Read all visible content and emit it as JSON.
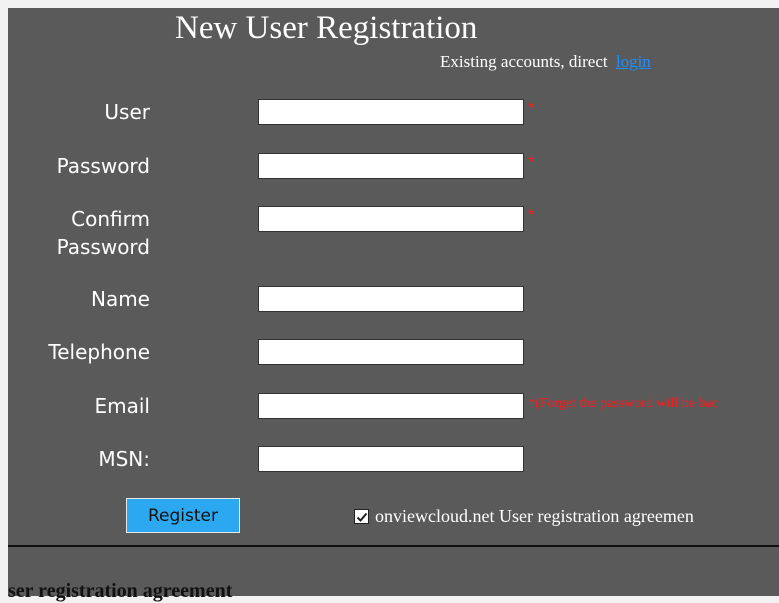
{
  "page": {
    "title": "New User Registration",
    "existing_text": "Existing accounts, direct",
    "login_link": "login"
  },
  "form": {
    "required_marker": "*",
    "fields": [
      {
        "label": "User",
        "value": "",
        "required": true
      },
      {
        "label": "Password",
        "value": "",
        "required": true
      },
      {
        "label": "Confirm Password",
        "value": "",
        "required": true
      },
      {
        "label": "Name",
        "value": ""
      },
      {
        "label": "Telephone",
        "value": ""
      },
      {
        "label": "Email",
        "value": "",
        "required": true,
        "note": "(Forget the password will be bac"
      },
      {
        "label": "MSN:",
        "value": ""
      }
    ],
    "register_label": "Register",
    "agreement": {
      "checked": true,
      "label": "onviewcloud.net User registration agreemen"
    }
  },
  "agreement_section": {
    "heading": "ser registration agreement"
  },
  "colors": {
    "background": "#5a5a5a",
    "required": "#ff1a1a",
    "link": "#1e90ff",
    "button": "#2ba8f0"
  },
  "icons": {
    "check": "check-icon"
  }
}
